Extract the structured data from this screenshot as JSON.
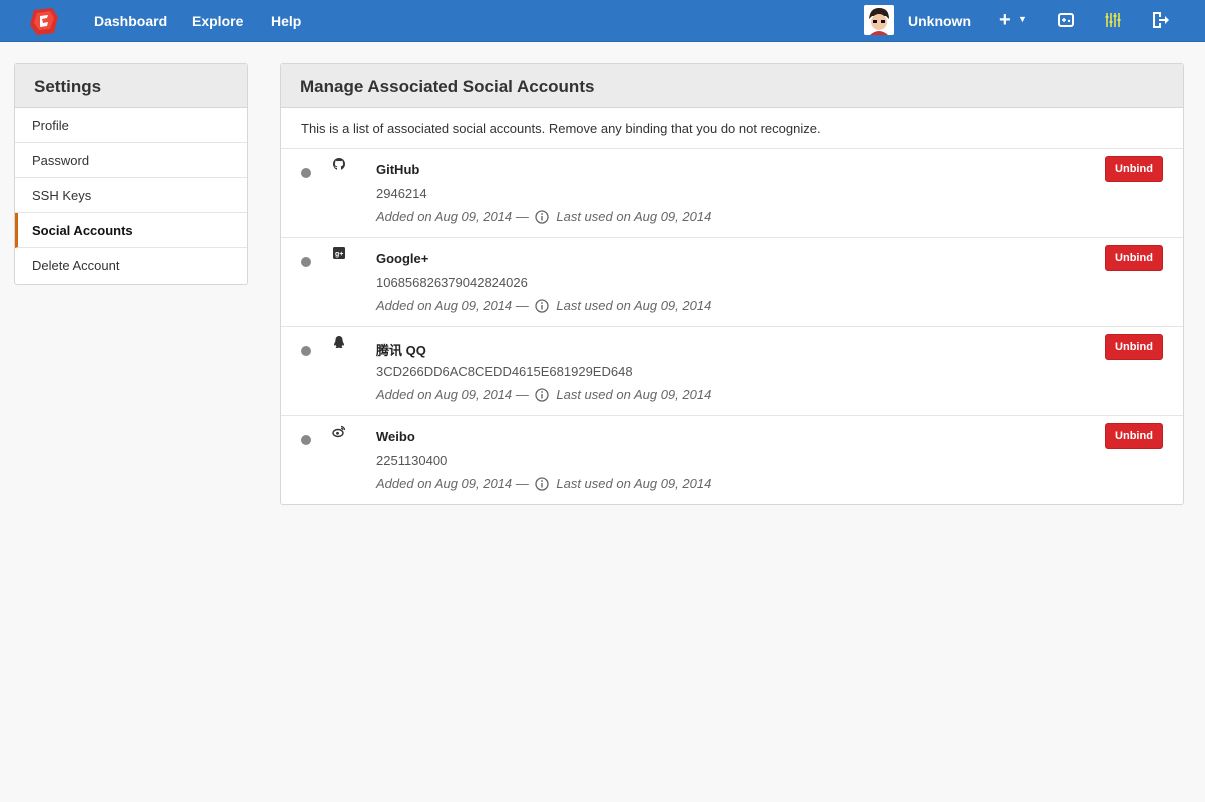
{
  "nav": {
    "links": [
      "Dashboard",
      "Explore",
      "Help"
    ],
    "user_name": "Unknown",
    "plus_label": "+",
    "icons": [
      "logo-icon",
      "avatar",
      "plus-icon",
      "caret-down-icon",
      "gamepad-icon",
      "settings-sliders-icon",
      "sign-out-icon"
    ]
  },
  "sidebar": {
    "title": "Settings",
    "items": [
      {
        "label": "Profile"
      },
      {
        "label": "Password"
      },
      {
        "label": "SSH Keys"
      },
      {
        "label": "Social Accounts"
      },
      {
        "label": "Delete Account"
      }
    ],
    "active_index": 3
  },
  "main": {
    "title": "Manage Associated Social Accounts",
    "description": "This is a list of associated social accounts. Remove any binding that you do not recognize.",
    "unbind_label": "Unbind",
    "accounts": [
      {
        "provider": "GitHub",
        "id": "2946214",
        "added": "Added on Aug 09, 2014 —",
        "last_used": "Last used on Aug 09, 2014",
        "icon": "github-icon"
      },
      {
        "provider": "Google+",
        "id": "106856826379042824026",
        "added": "Added on Aug 09, 2014 —",
        "last_used": "Last used on Aug 09, 2014",
        "icon": "google-plus-icon"
      },
      {
        "provider": "腾讯 QQ",
        "id": "3CD266DD6AC8CEDD4615E681929ED648",
        "added": "Added on Aug 09, 2014 —",
        "last_used": "Last used on Aug 09, 2014",
        "icon": "qq-icon"
      },
      {
        "provider": "Weibo",
        "id": "2251130400",
        "added": "Added on Aug 09, 2014 —",
        "last_used": "Last used on Aug 09, 2014",
        "icon": "weibo-icon"
      }
    ]
  },
  "colors": {
    "navbar": "#2f76c4",
    "active_accent": "#d26911",
    "unbind_button": "#d9262b",
    "background": "#f8f8f8"
  }
}
